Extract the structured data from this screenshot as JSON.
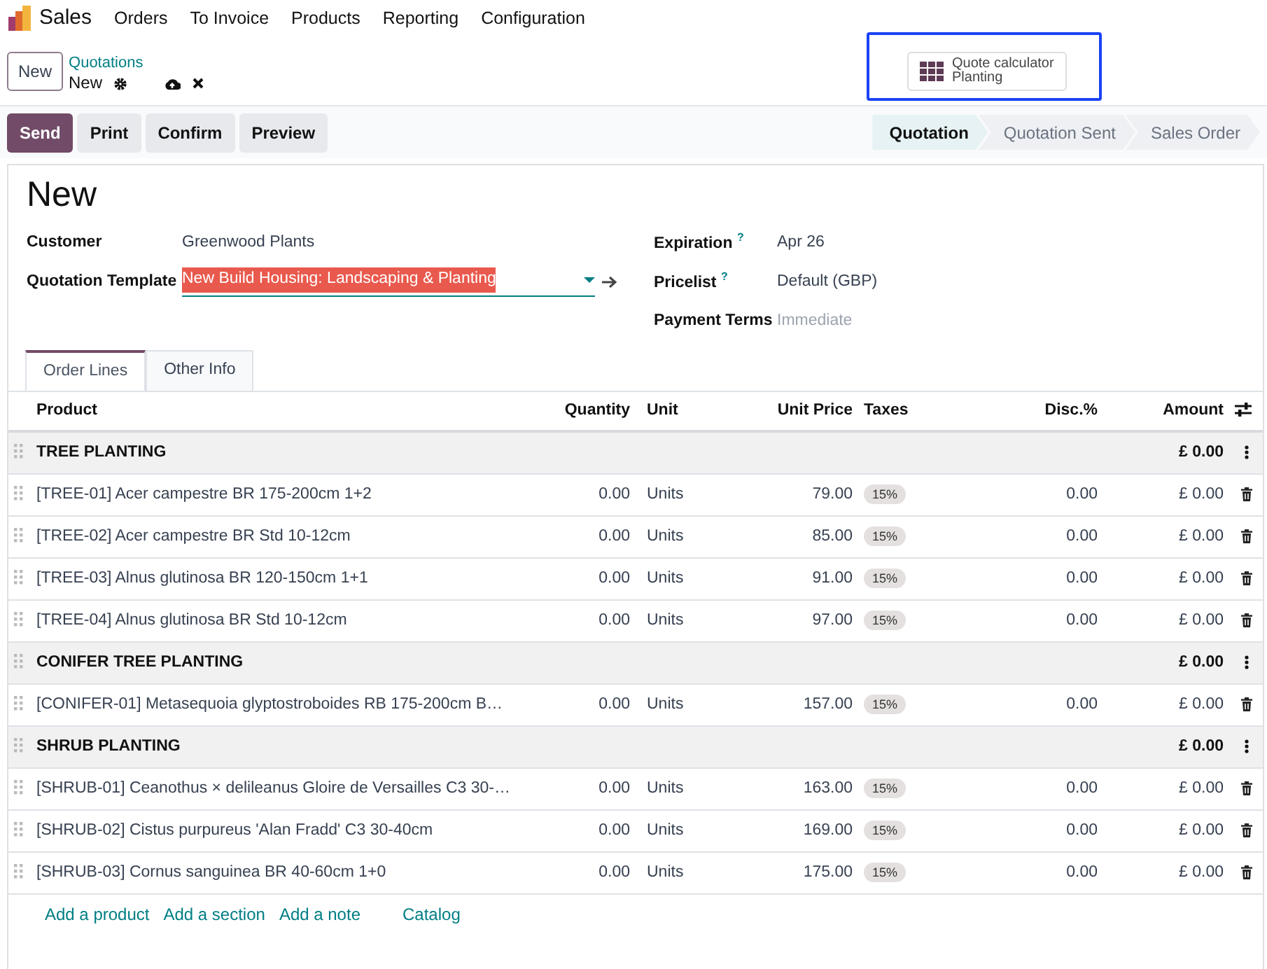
{
  "navbar": {
    "app": "Sales",
    "menus": [
      "Orders",
      "To Invoice",
      "Products",
      "Reporting",
      "Configuration"
    ]
  },
  "control_panel": {
    "new_button": "New",
    "breadcrumb": "Quotations",
    "record": "New",
    "calculator": {
      "title": "Quote calculator",
      "subtitle": "Planting",
      "highlighted": true
    }
  },
  "actions": [
    {
      "label": "Send",
      "primary": true
    },
    {
      "label": "Print",
      "primary": false
    },
    {
      "label": "Confirm",
      "primary": false
    },
    {
      "label": "Preview",
      "primary": false
    }
  ],
  "stages": [
    {
      "label": "Quotation",
      "selected": true
    },
    {
      "label": "Quotation Sent",
      "selected": false
    },
    {
      "label": "Sales Order",
      "selected": false
    }
  ],
  "form": {
    "title": "New",
    "left": [
      {
        "label": "Customer",
        "value": "Greenwood Plants",
        "kind": "text"
      },
      {
        "label": "Quotation Template",
        "value": "New Build Housing: Landscaping & Planting",
        "kind": "many2one"
      }
    ],
    "right": [
      {
        "label": "Expiration",
        "help": "?",
        "value": "Apr 26"
      },
      {
        "label": "Pricelist",
        "help": "?",
        "value": "Default (GBP)"
      },
      {
        "label": "Payment Terms",
        "placeholder": "Immediate"
      }
    ]
  },
  "tabs": [
    {
      "label": "Order Lines",
      "selected": true
    },
    {
      "label": "Other Info",
      "selected": false
    }
  ],
  "table": {
    "columns": [
      "Product",
      "Quantity",
      "Unit",
      "Unit Price",
      "Taxes",
      "Disc.%",
      "Amount"
    ],
    "rows": [
      {
        "kind": "section",
        "name": "TREE PLANTING",
        "amount": "£ 0.00"
      },
      {
        "kind": "line",
        "product": "[TREE-01] Acer campestre BR 175-200cm 1+2",
        "quantity": "0.00",
        "unit": "Units",
        "unit_price": "79.00",
        "tax": "15%",
        "discount": "0.00",
        "amount": "£ 0.00"
      },
      {
        "kind": "line",
        "product": "[TREE-02] Acer campestre BR Std 10-12cm",
        "quantity": "0.00",
        "unit": "Units",
        "unit_price": "85.00",
        "tax": "15%",
        "discount": "0.00",
        "amount": "£ 0.00"
      },
      {
        "kind": "line",
        "product": "[TREE-03] Alnus glutinosa BR 120-150cm 1+1",
        "quantity": "0.00",
        "unit": "Units",
        "unit_price": "91.00",
        "tax": "15%",
        "discount": "0.00",
        "amount": "£ 0.00"
      },
      {
        "kind": "line",
        "product": "[TREE-04] Alnus glutinosa BR Std 10-12cm",
        "quantity": "0.00",
        "unit": "Units",
        "unit_price": "97.00",
        "tax": "15%",
        "discount": "0.00",
        "amount": "£ 0.00"
      },
      {
        "kind": "section",
        "name": "CONIFER TREE PLANTING",
        "amount": "£ 0.00"
      },
      {
        "kind": "line",
        "product": "[CONIFER-01] Metasequoia glyptostroboides RB 175-200cm B…",
        "quantity": "0.00",
        "unit": "Units",
        "unit_price": "157.00",
        "tax": "15%",
        "discount": "0.00",
        "amount": "£ 0.00"
      },
      {
        "kind": "section",
        "name": "SHRUB PLANTING",
        "amount": "£ 0.00"
      },
      {
        "kind": "line",
        "product": "[SHRUB-01] Ceanothus × delileanus Gloire de Versailles C3 30-…",
        "quantity": "0.00",
        "unit": "Units",
        "unit_price": "163.00",
        "tax": "15%",
        "discount": "0.00",
        "amount": "£ 0.00"
      },
      {
        "kind": "line",
        "product": "[SHRUB-02] Cistus purpureus 'Alan Fradd' C3 30-40cm",
        "quantity": "0.00",
        "unit": "Units",
        "unit_price": "169.00",
        "tax": "15%",
        "discount": "0.00",
        "amount": "£ 0.00"
      },
      {
        "kind": "line",
        "product": "[SHRUB-03] Cornus sanguinea BR 40-60cm 1+0",
        "quantity": "0.00",
        "unit": "Units",
        "unit_price": "175.00",
        "tax": "15%",
        "discount": "0.00",
        "amount": "£ 0.00"
      }
    ],
    "add_links": [
      "Add a product",
      "Add a section",
      "Add a note",
      "Catalog"
    ]
  }
}
